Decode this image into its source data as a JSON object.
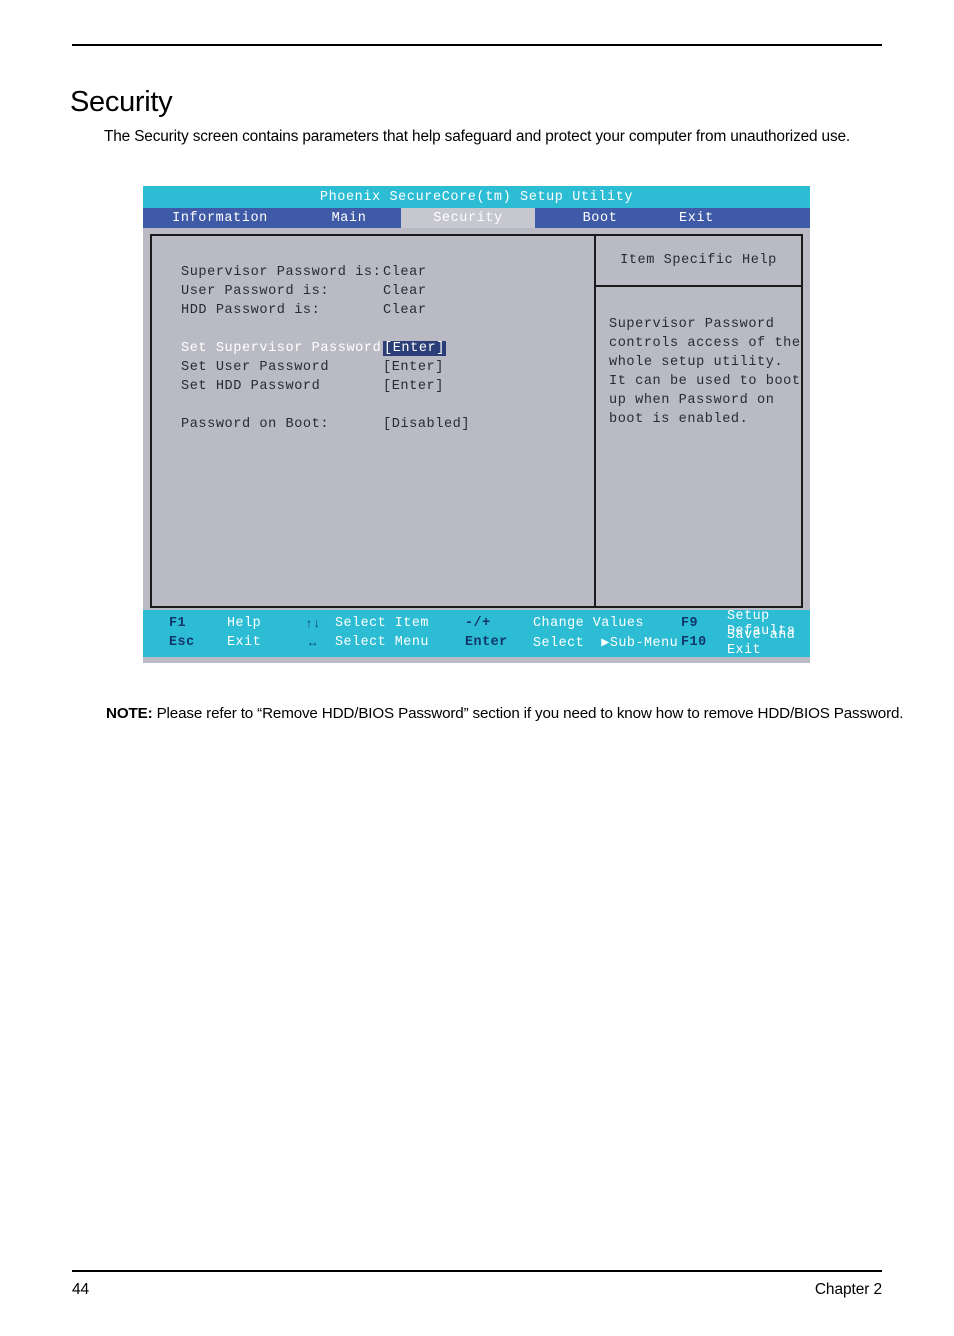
{
  "document": {
    "title": "Security",
    "intro": "The Security screen contains parameters that help safeguard and protect your computer from unauthorized use.",
    "note_label": "NOTE:",
    "note_text": "Please refer to “Remove HDD/BIOS Password” section if you need to know how to remove HDD/BIOS Password.",
    "page_number": "44",
    "chapter": "Chapter 2"
  },
  "bios": {
    "title": "Phoenix  SecureCore(tm)  Setup  Utility",
    "tabs": [
      {
        "label": "Information",
        "active": false
      },
      {
        "label": "Main",
        "active": false
      },
      {
        "label": "Security",
        "active": true
      },
      {
        "label": "Boot",
        "active": false
      },
      {
        "label": "Exit",
        "active": false
      }
    ],
    "settings": [
      {
        "label": "Supervisor Password is:",
        "value": "Clear",
        "selected": false,
        "highlight": false
      },
      {
        "label": "User Password is:",
        "value": "Clear",
        "selected": false,
        "highlight": false
      },
      {
        "label": "HDD Password is:",
        "value": "Clear",
        "selected": false,
        "highlight": false
      },
      {
        "label": "Set Supervisor Password",
        "value": "[Enter]",
        "selected": true,
        "highlight": true
      },
      {
        "label": "Set User Password",
        "value": "[Enter]",
        "selected": false,
        "highlight": false
      },
      {
        "label": "Set HDD Password",
        "value": "[Enter]",
        "selected": false,
        "highlight": false
      },
      {
        "label": "Password on Boot:",
        "value": "[Disabled]",
        "selected": false,
        "highlight": false
      }
    ],
    "help": {
      "title": "Item  Specific  Help",
      "lines": [
        "Supervisor Password",
        "controls access of the",
        "whole setup utility.",
        "It can be used to boot",
        "up when Password on",
        "boot is enabled."
      ]
    },
    "footer": {
      "row1": {
        "key1": "F1",
        "desc1": "Help",
        "key2": "↑↓",
        "desc2": "Select  Item",
        "key3": "-/+",
        "desc3": "Change  Values",
        "key4": "F9",
        "desc4": "Setup  Defaults"
      },
      "row2": {
        "key1": "Esc",
        "desc1": "Exit",
        "key2": "↔",
        "desc2": "Select  Menu",
        "key3": "Enter",
        "desc3": "Select",
        "desc3b": "▶Sub-Menu",
        "key4": "F10",
        "desc4": "Save  and  Exit"
      }
    },
    "colors": {
      "titlebar": "#2cbcd4",
      "tabbar": "#3f5aa6",
      "active_tab": "#c6c7cf",
      "panel": "#b9bac4",
      "selection": "#2c3e77",
      "key_text": "#12356e"
    }
  }
}
